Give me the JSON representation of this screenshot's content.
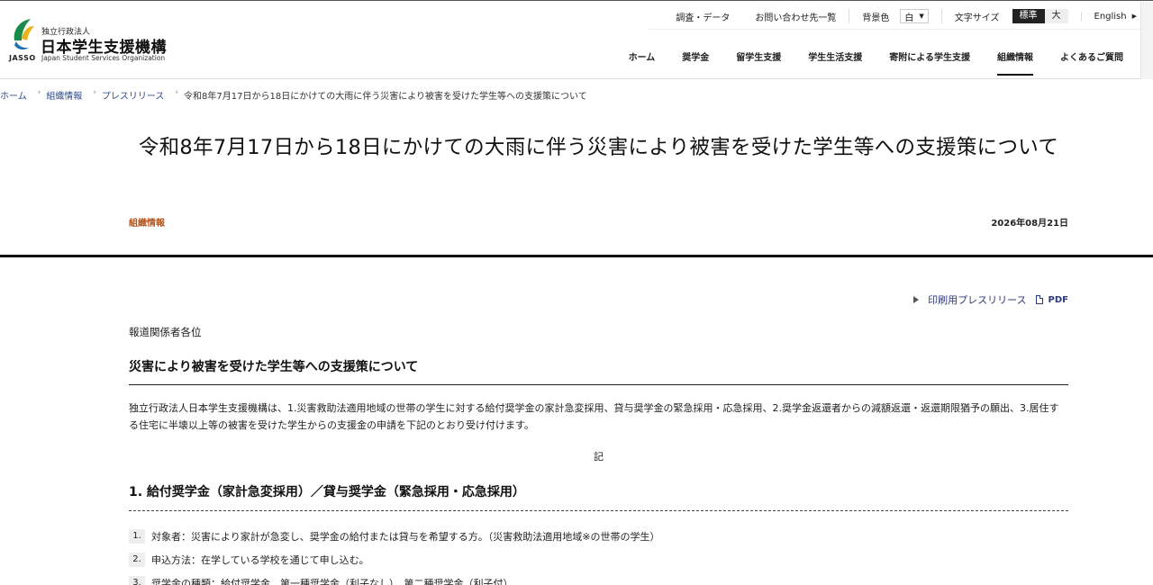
{
  "header": {
    "logo": {
      "sub": "独立行政法人",
      "main": "日本学生支援機構",
      "jasso": "JASSO",
      "en": "Japan Student Services Organization"
    },
    "utility": {
      "survey": "調査・データ",
      "contacts": "お問い合わせ先一覧",
      "bg_label": "背景色",
      "bg_value": "白",
      "fontsize_label": "文字サイズ",
      "fontsize_standard": "標準",
      "fontsize_large": "大",
      "lang": "English"
    },
    "nav": [
      {
        "label": "ホーム"
      },
      {
        "label": "奨学金"
      },
      {
        "label": "留学生支援"
      },
      {
        "label": "学生生活支援"
      },
      {
        "label": "寄附による学生支援"
      },
      {
        "label": "組織情報",
        "active": true
      },
      {
        "label": "よくあるご質問"
      }
    ]
  },
  "breadcrumb": [
    "ホーム",
    "組織情報",
    "プレスリリース",
    "令和8年7月17日から18日にかけての大雨に伴う災害により被害を受けた学生等への支援策について"
  ],
  "article": {
    "title": "令和8年7月17日から18日にかけての大雨に伴う災害により被害を受けた学生等への支援策について",
    "category": "組織情報",
    "date": "2026年08月21日",
    "print_link": "印刷用プレスリリース",
    "pdf_label": "PDF",
    "greeting": "報道関係者各位",
    "heading": "災害により被害を受けた学生等への支援策について",
    "lead": "独立行政法人日本学生支援機構は、1.災害救助法適用地域の世帯の学生に対する給付奨学金の家計急変採用、貸与奨学金の緊急採用・応急採用、2.奨学金返還者からの減額返還・返還期限猶予の願出、3.居住する住宅に半壊以上等の被害を受けた学生からの支援金の申請を下記のとおり受け付けます。",
    "ki": "記",
    "section1": {
      "heading": "1. 給付奨学金（家計急変採用）／貸与奨学金（緊急採用・応急採用）",
      "items": [
        {
          "num": "1.",
          "text": "対象者：災害により家計が急変し、奨学金の給付または貸与を希望する方。（災害救助法適用地域※の世帯の学生）"
        },
        {
          "num": "2.",
          "text": "申込方法：在学している学校を通じて申し込む。"
        },
        {
          "num": "3.",
          "text": "奨学金の種類：給付奨学金、第一種奨学金（利子なし）、第二種奨学金（利子付）"
        }
      ]
    }
  }
}
